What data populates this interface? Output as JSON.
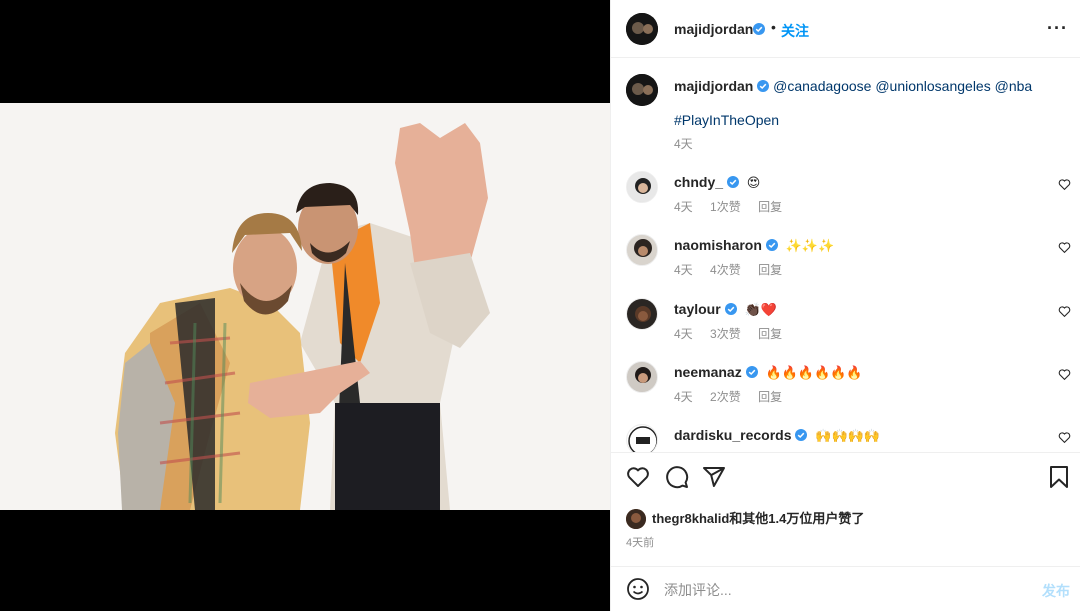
{
  "post": {
    "username": "majidjordan",
    "separator": "•",
    "follow_label": "关注",
    "more_label": "···"
  },
  "caption": {
    "username": "majidjordan",
    "mentions": "@canadagoose @unionlosangeles @nba",
    "hashtag": "#PlayInTheOpen",
    "time": "4天"
  },
  "comments": [
    {
      "username": "chndy_",
      "text": "😍",
      "time": "4天",
      "likes": "1次赞",
      "reply": "回复"
    },
    {
      "username": "naomisharon",
      "text": "✨✨✨",
      "time": "4天",
      "likes": "4次赞",
      "reply": "回复"
    },
    {
      "username": "taylour",
      "text": "👏🏿❤️",
      "time": "4天",
      "likes": "3次赞",
      "reply": "回复"
    },
    {
      "username": "neemanaz",
      "text": "🔥🔥🔥🔥🔥🔥",
      "time": "4天",
      "likes": "2次赞",
      "reply": "回复"
    },
    {
      "username": "dardisku_records",
      "text": "🙌🙌🙌🙌",
      "time": "",
      "likes": "",
      "reply": ""
    }
  ],
  "likes": {
    "text": "thegr8khalid和其他1.4万位用户赞了"
  },
  "post_time": "4天前",
  "add_comment": {
    "placeholder": "添加评论...",
    "post_label": "发布"
  },
  "icons": {
    "like": "heart-icon",
    "comment": "comment-icon",
    "share": "paper-plane-icon",
    "save": "bookmark-icon",
    "emoji": "smiley-icon",
    "verified": "verified-badge-icon"
  },
  "colors": {
    "accent": "#0095f6",
    "verified": "#3897f0",
    "link": "#00376b",
    "muted": "#8e8e8e"
  }
}
